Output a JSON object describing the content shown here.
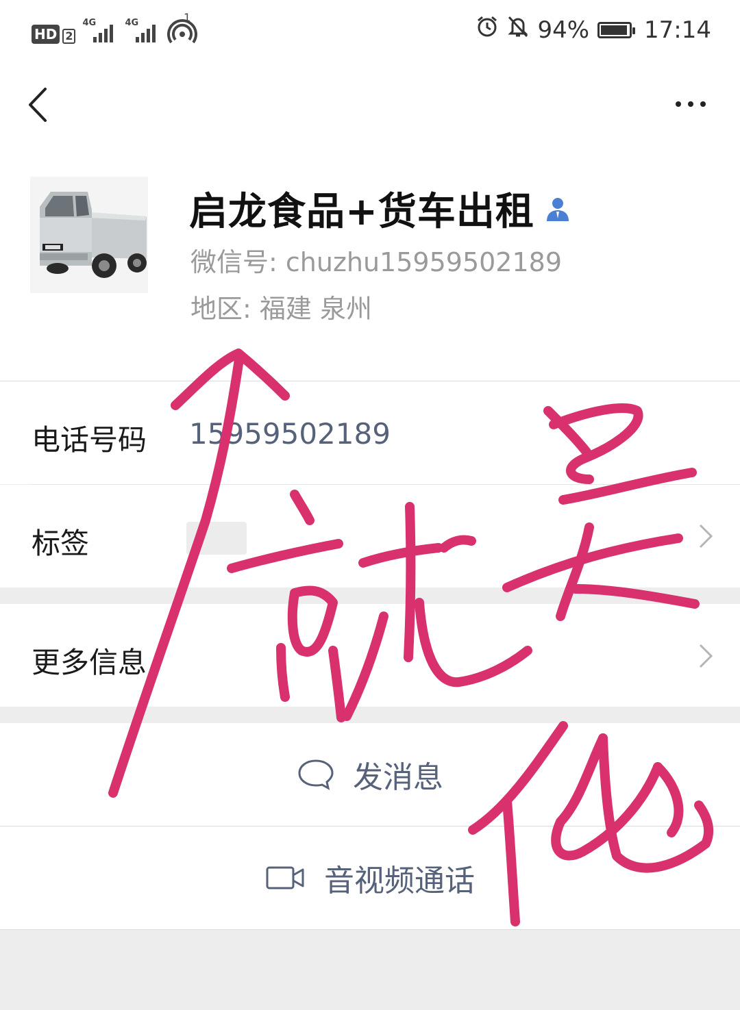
{
  "statusbar": {
    "hd_label": "HD",
    "hd_sub": "2",
    "signal_1": "4G",
    "signal_2": "4G",
    "hotspot_count": "1",
    "battery_percent": "94%",
    "battery_level": 0.94,
    "time": "17:14"
  },
  "profile": {
    "name": "启龙食品+货车出租",
    "wechat_id": "微信号: chuzhu15959502189",
    "region": "地区: 福建  泉州"
  },
  "rows": {
    "phone_label": "电话号码",
    "phone_value": "15959502189",
    "tags_label": "标签",
    "more_info_label": "更多信息"
  },
  "actions": {
    "send_message": "发消息",
    "video_call": "音视频通话"
  },
  "annotation": {
    "handwriting": "就是他",
    "color": "#d8316e"
  },
  "colors": {
    "link_blue": "#56617a",
    "background": "#ededed",
    "contact_icon": "#4a7fd4"
  }
}
